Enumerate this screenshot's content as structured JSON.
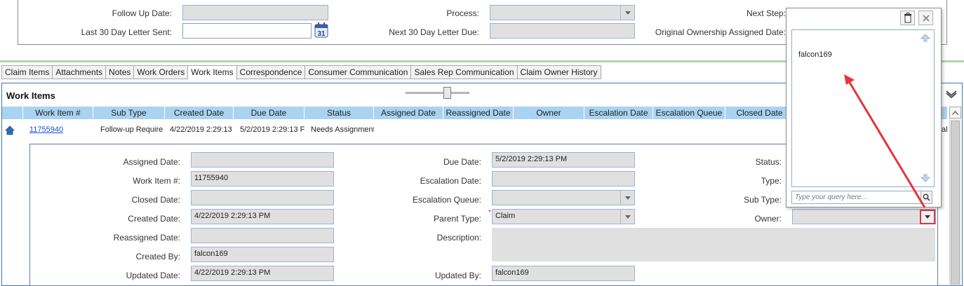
{
  "top_form": {
    "follow_up_date_label": "Follow Up Date:",
    "follow_up_date_value": "",
    "last_30_label": "Last 30 Day Letter Sent:",
    "last_30_value": "",
    "process_label": "Process:",
    "process_value": "",
    "next_30_label": "Next 30 Day Letter Due:",
    "next_30_value": "",
    "next_step_label": "Next Step:",
    "orig_ownership_label": "Original Ownership Assigned Date:"
  },
  "tabs": [
    {
      "label": "Claim Items"
    },
    {
      "label": "Attachments"
    },
    {
      "label": "Notes"
    },
    {
      "label": "Work Orders"
    },
    {
      "label": "Work Items"
    },
    {
      "label": "Correspondence"
    },
    {
      "label": "Consumer Communication"
    },
    {
      "label": "Sales Rep Communication"
    },
    {
      "label": "Claim Owner History"
    }
  ],
  "active_tab": "Work Items",
  "work_items": {
    "title": "Work Items",
    "columns": [
      "Work Item #",
      "Sub Type",
      "Created Date",
      "Due Date",
      "Status",
      "Assigned Date",
      "Reassigned Date",
      "Owner",
      "Escalation Date",
      "Escalation Queue",
      "Closed Date"
    ],
    "row": {
      "work_item": "11755940",
      "sub_type": "Follow-up Require",
      "created": "4/22/2019 2:29:13",
      "due": "5/2/2019 2:29:13 F",
      "status": "Needs Assignment",
      "trailing": "fal"
    }
  },
  "detail": {
    "assigned_date_label": "Assigned Date:",
    "assigned_date_value": "",
    "work_item_label": "Work Item #:",
    "work_item_value": "11755940",
    "closed_date_label": "Closed Date:",
    "closed_date_value": "",
    "created_date_label": "Created Date:",
    "created_date_value": "4/22/2019 2:29:13 PM",
    "reassigned_date_label": "Reassigned Date:",
    "reassigned_date_value": "",
    "created_by_label": "Created By:",
    "created_by_value": "falcon169",
    "updated_date_label": "Updated Date:",
    "updated_date_value": "4/22/2019 2:29:13 PM",
    "due_date_label": "Due Date:",
    "due_date_value": "5/2/2019 2:29:13 PM",
    "escalation_date_label": "Escalation Date:",
    "escalation_date_value": "",
    "escalation_queue_label": "Escalation Queue:",
    "escalation_queue_value": "",
    "parent_type_label": "Parent Type:",
    "parent_type_required": "*",
    "parent_type_value": "Claim",
    "description_label": "Description:",
    "description_value": "",
    "updated_by_label": "Updated By:",
    "updated_by_value": "falcon169",
    "status_label": "Status:",
    "type_label": "Type:",
    "sub_type_label": "Sub Type:",
    "owner_label": "Owner:",
    "owner_value": ""
  },
  "popup": {
    "result": "falcon169",
    "query_placeholder": "Type your query here..."
  },
  "colors": {
    "grid_header": "#a9d3f0",
    "panel_border": "#3f74b5",
    "annotation_red": "#e8343a"
  }
}
